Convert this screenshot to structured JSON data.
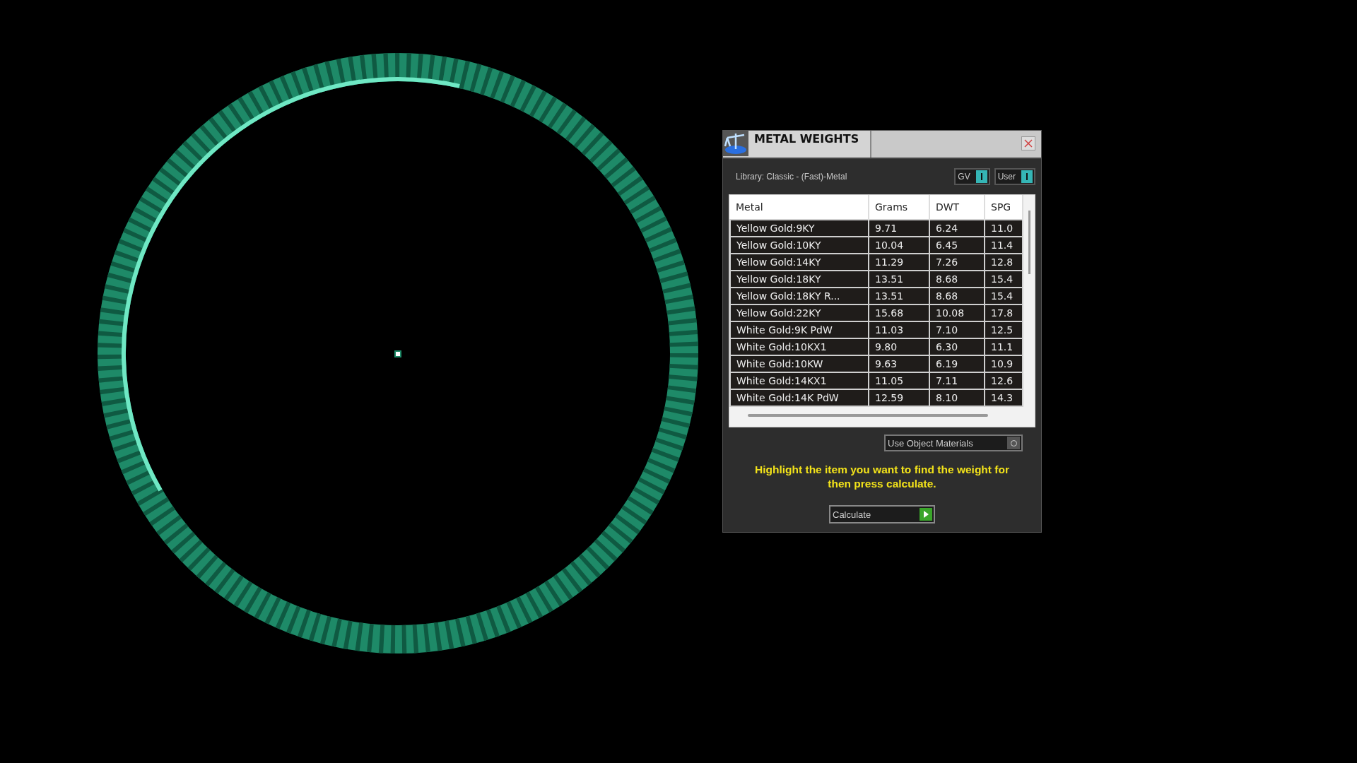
{
  "window": {
    "title": "METAL WEIGHTS"
  },
  "library": "Library: Classic - (Fast)-Metal",
  "toggles": [
    {
      "label": "GV",
      "on": true
    },
    {
      "label": "User",
      "on": true
    }
  ],
  "table": {
    "columns": [
      "Metal",
      "Grams",
      "DWT",
      "SPG"
    ],
    "rows": [
      [
        "Yellow Gold:9KY",
        "9.71",
        "6.24",
        "11.0"
      ],
      [
        "Yellow Gold:10KY",
        "10.04",
        "6.45",
        "11.4"
      ],
      [
        "Yellow Gold:14KY",
        "11.29",
        "7.26",
        "12.8"
      ],
      [
        "Yellow Gold:18KY",
        "13.51",
        "8.68",
        "15.4"
      ],
      [
        "Yellow Gold:18KY R...",
        "13.51",
        "8.68",
        "15.4"
      ],
      [
        "Yellow Gold:22KY",
        "15.68",
        "10.08",
        "17.8"
      ],
      [
        "White Gold:9K PdW",
        "11.03",
        "7.10",
        "12.5"
      ],
      [
        "White Gold:10KX1",
        "9.80",
        "6.30",
        "11.1"
      ],
      [
        "White Gold:10KW",
        "9.63",
        "6.19",
        "10.9"
      ],
      [
        "White Gold:14KX1",
        "11.05",
        "7.11",
        "12.6"
      ],
      [
        "White Gold:14K PdW",
        "12.59",
        "8.10",
        "14.3"
      ]
    ]
  },
  "use_object_materials": {
    "label": "Use Object Materials"
  },
  "hint": "Highlight the item you want to find the weight for then press calculate.",
  "calculate_button": "Calculate"
}
